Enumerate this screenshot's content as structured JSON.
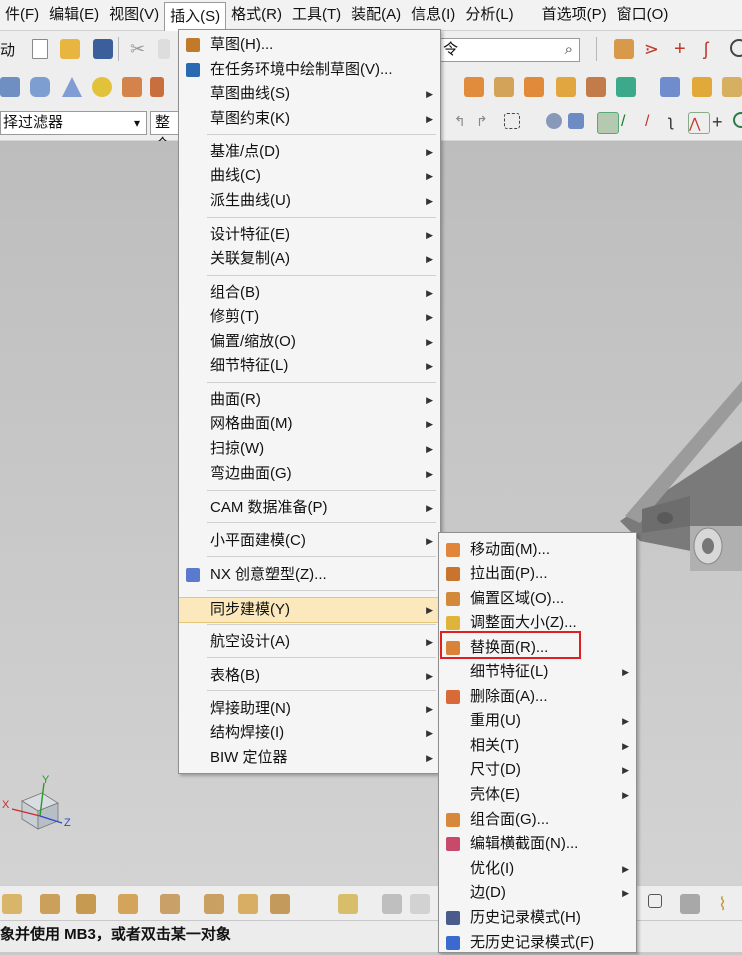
{
  "menubar": [
    "件(F)",
    "编辑(E)",
    "视图(V)",
    "插入(S)",
    "格式(R)",
    "工具(T)",
    "装配(A)",
    "信息(I)",
    "分析(L)",
    "首选项(P)",
    "窗口(O)"
  ],
  "toolbar": {
    "left_cut_label": "动",
    "command_finder_text": "令",
    "filter_label": "择过滤器",
    "filter_arrow": "▾",
    "scope_label": "整个",
    "search_icon": "⌕"
  },
  "insert_menu": {
    "items": [
      {
        "label": "草图(H)...",
        "icon": "sketch-icon",
        "submenu": false
      },
      {
        "label": "在任务环境中绘制草图(V)...",
        "icon": "sketch-task-icon",
        "submenu": false
      },
      {
        "label": "草图曲线(S)",
        "submenu": true
      },
      {
        "label": "草图约束(K)",
        "submenu": true
      },
      {
        "label": "基准/点(D)",
        "submenu": true
      },
      {
        "label": "曲线(C)",
        "submenu": true
      },
      {
        "label": "派生曲线(U)",
        "submenu": true
      },
      {
        "label": "设计特征(E)",
        "submenu": true
      },
      {
        "label": "关联复制(A)",
        "submenu": true
      },
      {
        "label": "组合(B)",
        "submenu": true
      },
      {
        "label": "修剪(T)",
        "submenu": true
      },
      {
        "label": "偏置/缩放(O)",
        "submenu": true
      },
      {
        "label": "细节特征(L)",
        "submenu": true
      },
      {
        "label": "曲面(R)",
        "submenu": true
      },
      {
        "label": "网格曲面(M)",
        "submenu": true
      },
      {
        "label": "扫掠(W)",
        "submenu": true
      },
      {
        "label": "弯边曲面(G)",
        "submenu": true
      },
      {
        "label": "CAM 数据准备(P)",
        "submenu": true
      },
      {
        "label": "小平面建模(C)",
        "submenu": true
      },
      {
        "label": "NX 创意塑型(Z)...",
        "icon": "nx-realize-shape-icon",
        "submenu": false
      },
      {
        "label": "同步建模(Y)",
        "submenu": true,
        "highlighted": true
      },
      {
        "label": "航空设计(A)",
        "submenu": true
      },
      {
        "label": "表格(B)",
        "submenu": true
      },
      {
        "label": "焊接助理(N)",
        "submenu": true
      },
      {
        "label": "结构焊接(I)",
        "submenu": true
      },
      {
        "label": "BIW 定位器",
        "submenu": true
      }
    ]
  },
  "sync_menu": {
    "items": [
      {
        "label": "移动面(M)...",
        "icon": "move-face-icon",
        "submenu": false
      },
      {
        "label": "拉出面(P)...",
        "icon": "pull-face-icon",
        "submenu": false
      },
      {
        "label": "偏置区域(O)...",
        "icon": "offset-region-icon",
        "submenu": false
      },
      {
        "label": "调整面大小(Z)...",
        "icon": "resize-face-icon",
        "submenu": false
      },
      {
        "label": "替换面(R)...",
        "icon": "replace-face-icon",
        "submenu": false,
        "boxed": true
      },
      {
        "label": "细节特征(L)",
        "submenu": true
      },
      {
        "label": "删除面(A)...",
        "icon": "delete-face-icon",
        "submenu": false
      },
      {
        "label": "重用(U)",
        "submenu": true
      },
      {
        "label": "相关(T)",
        "submenu": true
      },
      {
        "label": "尺寸(D)",
        "submenu": true
      },
      {
        "label": "壳体(E)",
        "submenu": true
      },
      {
        "label": "组合面(G)...",
        "icon": "group-face-icon",
        "submenu": false
      },
      {
        "label": "编辑横截面(N)...",
        "icon": "edit-section-icon",
        "submenu": false
      },
      {
        "label": "优化(I)",
        "submenu": true
      },
      {
        "label": "边(D)",
        "submenu": true
      },
      {
        "label": "历史记录模式(H)",
        "icon": "history-mode-icon",
        "submenu": false
      },
      {
        "label": "无历史记录模式(F)",
        "icon": "history-free-mode-icon",
        "submenu": false
      }
    ]
  },
  "triad": {
    "x": "X",
    "y": "Y",
    "z": "Z"
  },
  "status_text": "象并使用 MB3，或者双击某一对象",
  "colors": {
    "highlight": "#fbe9bd",
    "callout_red": "#e02020",
    "menu_bg": "#f5f5f5"
  }
}
